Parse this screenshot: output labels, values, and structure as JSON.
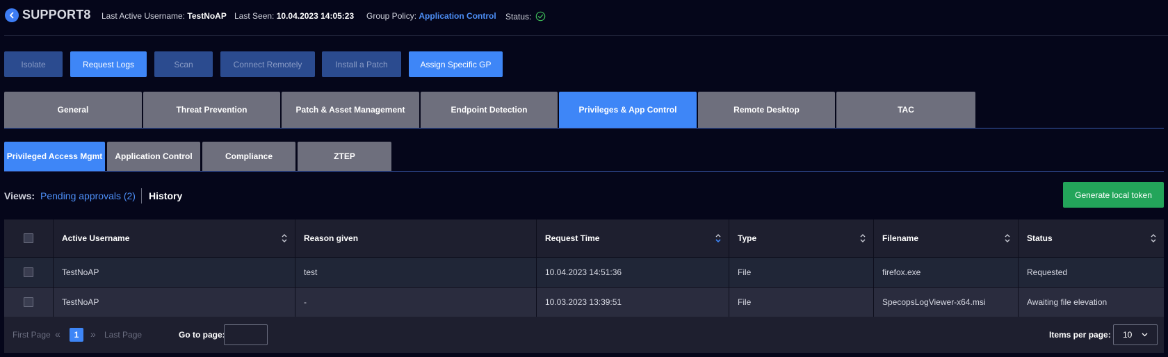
{
  "header": {
    "brand": "SUPPORT8",
    "last_active_label": "Last Active Username:",
    "last_active_value": "TestNoAP",
    "last_seen_label": "Last Seen:",
    "last_seen_value": "10.04.2023  14:05:23",
    "group_policy_label": "Group Policy:",
    "group_policy_value": "Application Control",
    "status_label": "Status:",
    "status_icon": "check-circle-icon",
    "status_color": "#3fbf5a"
  },
  "actions": [
    {
      "label": "Isolate",
      "state": "disabled"
    },
    {
      "label": "Request Logs",
      "state": "enabled"
    },
    {
      "label": "Scan",
      "state": "disabled"
    },
    {
      "label": "Connect Remotely",
      "state": "disabled"
    },
    {
      "label": "Install a Patch",
      "state": "disabled"
    },
    {
      "label": "Assign Specific GP",
      "state": "enabled"
    }
  ],
  "main_tabs": [
    {
      "label": "General"
    },
    {
      "label": "Threat Prevention"
    },
    {
      "label": "Patch & Asset Management"
    },
    {
      "label": "Endpoint Detection"
    },
    {
      "label": "Privileges & App Control",
      "active": true
    },
    {
      "label": "Remote Desktop"
    },
    {
      "label": "TAC"
    }
  ],
  "sub_tabs": [
    {
      "label": "Privileged Access Mgmt",
      "active": true
    },
    {
      "label": "Application Control"
    },
    {
      "label": "Compliance"
    },
    {
      "label": "ZTEP"
    }
  ],
  "views": {
    "label": "Views:",
    "pending": "Pending approvals (2)",
    "history": "History",
    "generate_token": "Generate local token"
  },
  "table": {
    "columns": [
      "Active Username",
      "Reason given",
      "Request Time",
      "Type",
      "Filename",
      "Status"
    ],
    "rows": [
      {
        "username": "TestNoAP",
        "reason": "test",
        "time": "10.04.2023  14:51:36",
        "type": "File",
        "filename": "firefox.exe",
        "status": "Requested"
      },
      {
        "username": "TestNoAP",
        "reason": "-",
        "time": "10.03.2023  13:39:51",
        "type": "File",
        "filename": "SpecopsLogViewer-x64.msi",
        "status": "Awaiting file elevation"
      }
    ]
  },
  "pagination": {
    "first": "First Page",
    "current": "1",
    "last": "Last Page",
    "goto_label": "Go to page:",
    "goto_value": "",
    "items_label": "Items per page:",
    "items_value": "10"
  },
  "colors": {
    "accent": "#3e86f7",
    "success": "#23a55a",
    "background": "#05061a"
  }
}
